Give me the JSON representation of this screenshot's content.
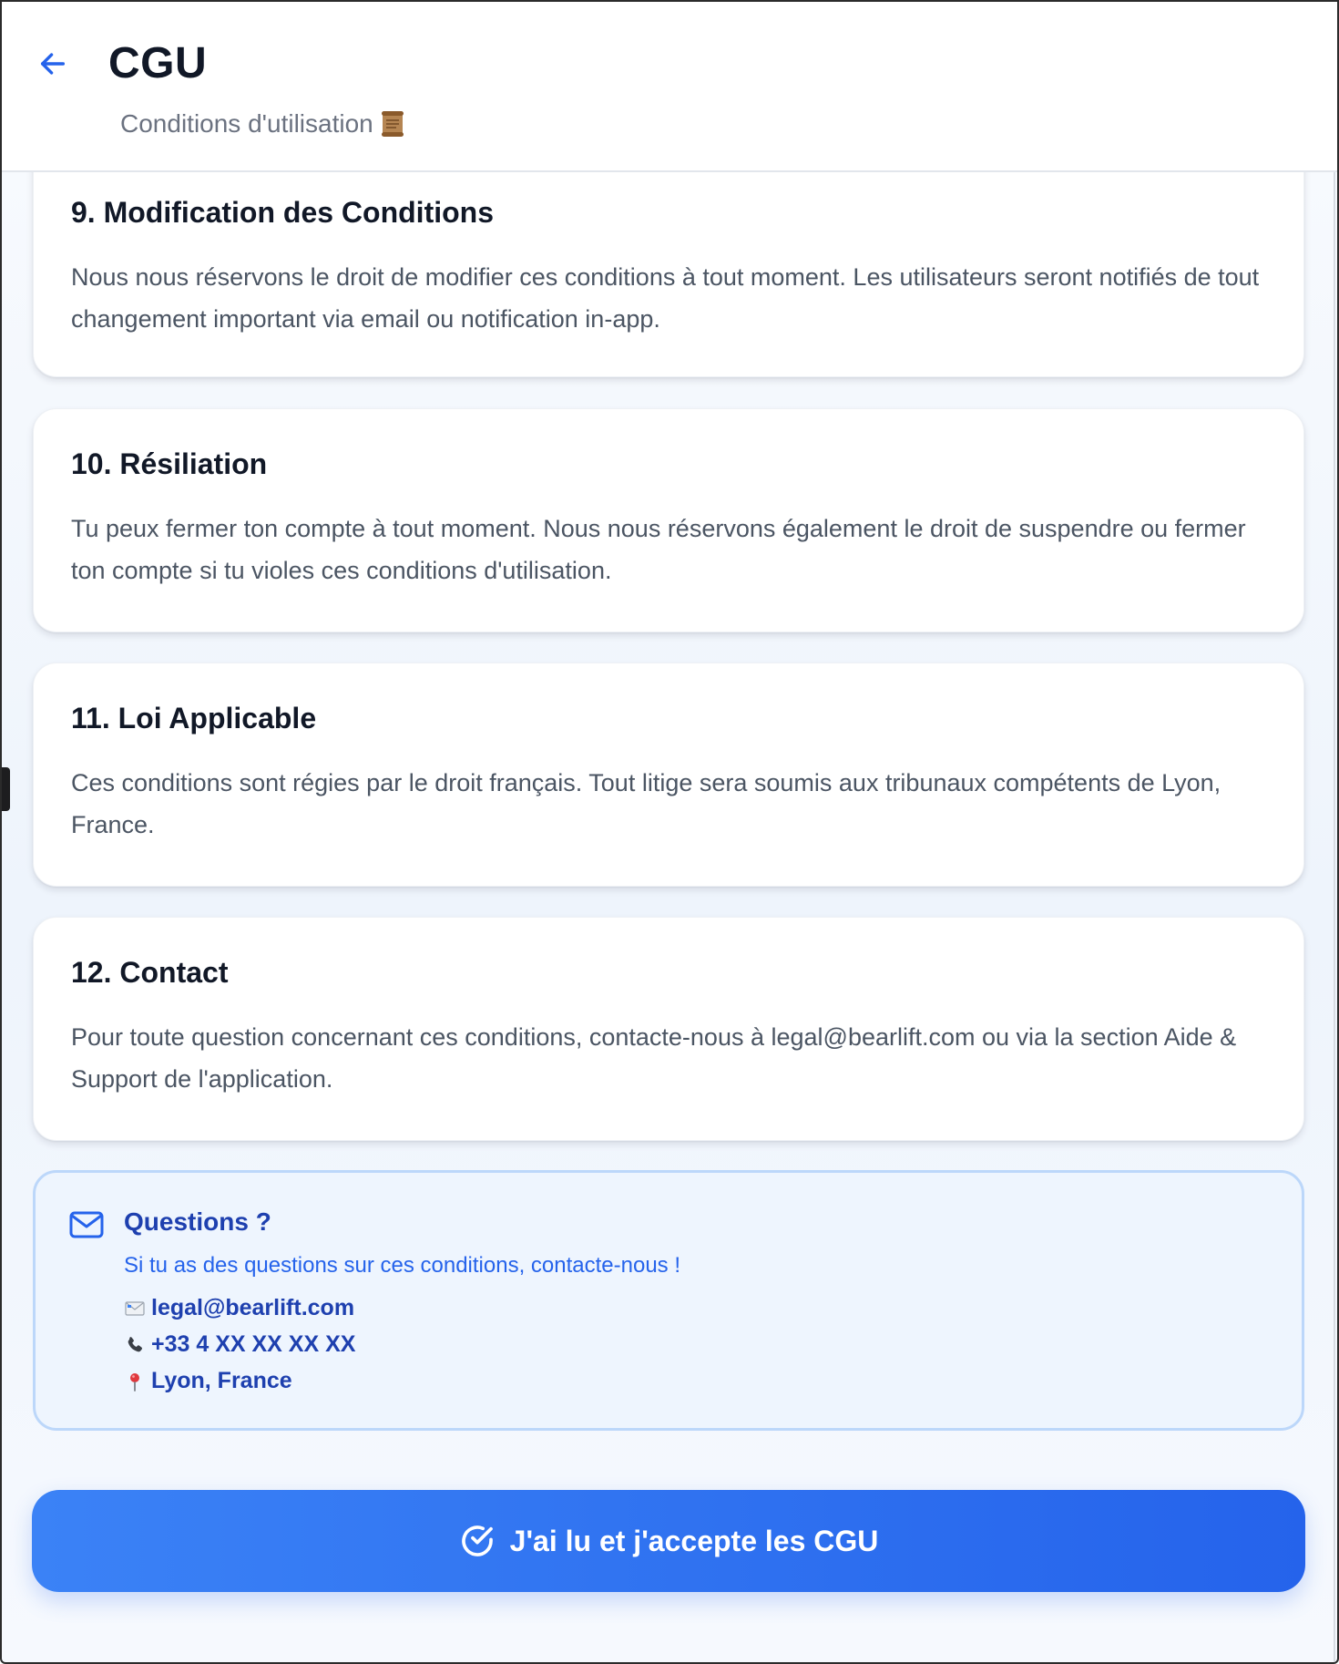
{
  "header": {
    "back_icon": "arrow-left-icon",
    "title": "CGU",
    "subtitle": "Conditions d'utilisation",
    "subtitle_icon": "scroll-icon"
  },
  "sections": [
    {
      "title": "9. Modification des Conditions",
      "body": "Nous nous réservons le droit de modifier ces conditions à tout moment. Les utilisateurs seront notifiés de tout changement important via email ou notification in-app."
    },
    {
      "title": "10. Résiliation",
      "body": "Tu peux fermer ton compte à tout moment. Nous nous réservons également le droit de suspendre ou fermer ton compte si tu violes ces conditions d'utilisation."
    },
    {
      "title": "11. Loi Applicable",
      "body": "Ces conditions sont régies par le droit français. Tout litige sera soumis aux tribunaux compétents de Lyon, France."
    },
    {
      "title": "12. Contact",
      "body": "Pour toute question concernant ces conditions, contacte-nous à legal@bearlift.com ou via la section Aide & Support de l'application."
    }
  ],
  "questions": {
    "icon": "mail-icon",
    "title": "Questions ?",
    "subtitle": "Si tu as des questions sur ces conditions, contacte-nous !",
    "email": "legal@bearlift.com",
    "phone": "+33 4 XX XX XX XX",
    "location": "Lyon, France"
  },
  "accept_button": {
    "icon": "check-circle-icon",
    "label": "J'ai lu et j'accepte les CGU"
  },
  "colors": {
    "accent": "#2563eb",
    "accent_light": "#3b82f6",
    "info_bg": "#eef5fe",
    "info_border": "#bcd7fa",
    "heading": "#111827",
    "body_text": "#4b5563"
  }
}
